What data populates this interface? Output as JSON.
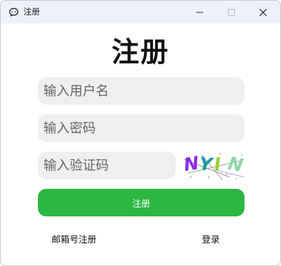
{
  "window": {
    "title": "注册",
    "controls": {
      "minimize_icon": "minimize-icon",
      "maximize_icon": "maximize-icon",
      "close_icon": "close-icon"
    },
    "app_icon": "chat-bubble-icon"
  },
  "form": {
    "heading": "注册",
    "username": {
      "placeholder": "输入用户名",
      "value": ""
    },
    "password": {
      "placeholder": "输入密码",
      "value": ""
    },
    "captcha_input": {
      "placeholder": "输入验证码",
      "value": ""
    },
    "captcha_image": {
      "chars": [
        "N",
        "Y",
        "I",
        "N"
      ],
      "colors": [
        "#8a2be2",
        "#1b9aa3",
        "#9acd32",
        "#8fd8a8"
      ]
    },
    "register_button": "注册"
  },
  "footer": {
    "email_register": "邮箱号注册",
    "login": "登录"
  },
  "colors": {
    "accent": "#2cb642",
    "titlebar": "#eef1fb",
    "field_bg": "#efefef"
  }
}
